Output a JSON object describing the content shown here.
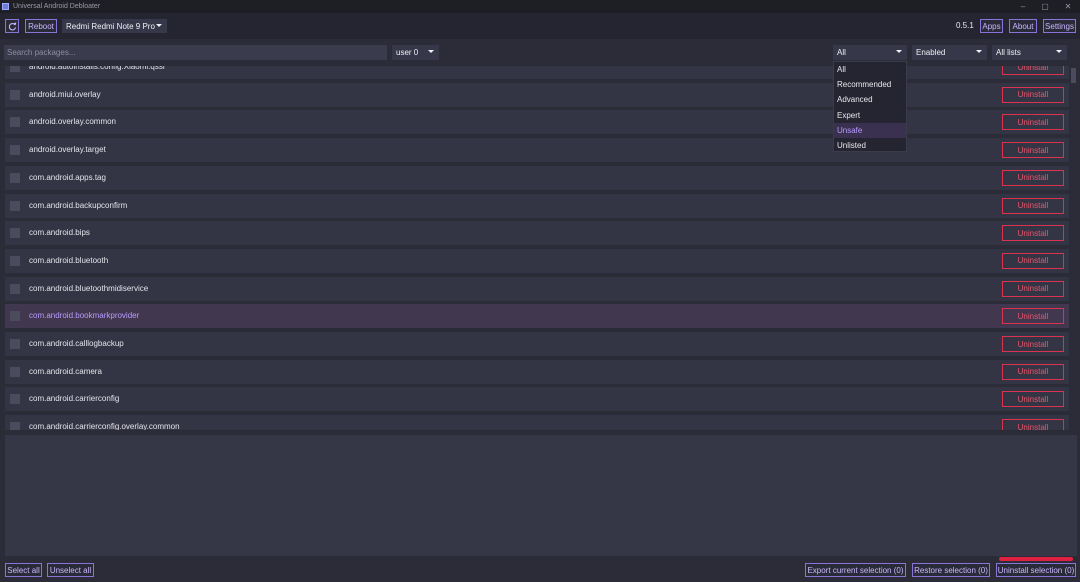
{
  "window": {
    "title": "Universal Android Debloater",
    "controls": [
      "–",
      "▢",
      "✕"
    ]
  },
  "toolbar": {
    "reboot_label": "Reboot",
    "device": "Redmi Redmi Note 9 Pro",
    "version": "0.5.1",
    "apps_label": "Apps",
    "about_label": "About",
    "settings_label": "Settings"
  },
  "filters": {
    "search_placeholder": "Search packages...",
    "user": "user 0",
    "removal": "All",
    "state": "Enabled",
    "list": "All lists",
    "removal_options": [
      "All",
      "Recommended",
      "Advanced",
      "Expert",
      "Unsafe",
      "Unlisted"
    ],
    "hovered_option": "Unsafe"
  },
  "packages": [
    {
      "name": "android.autoinstalls.config.Xiaomi.qssi",
      "action": "Uninstall"
    },
    {
      "name": "android.miui.overlay",
      "action": "Uninstall"
    },
    {
      "name": "android.overlay.common",
      "action": "Uninstall"
    },
    {
      "name": "android.overlay.target",
      "action": "Uninstall"
    },
    {
      "name": "com.android.apps.tag",
      "action": "Uninstall"
    },
    {
      "name": "com.android.backupconfirm",
      "action": "Uninstall"
    },
    {
      "name": "com.android.bips",
      "action": "Uninstall"
    },
    {
      "name": "com.android.bluetooth",
      "action": "Uninstall"
    },
    {
      "name": "com.android.bluetoothmidiservice",
      "action": "Uninstall"
    },
    {
      "name": "com.android.bookmarkprovider",
      "action": "Uninstall"
    },
    {
      "name": "com.android.calllogbackup",
      "action": "Uninstall"
    },
    {
      "name": "com.android.camera",
      "action": "Uninstall"
    },
    {
      "name": "com.android.carrierconfig",
      "action": "Uninstall"
    },
    {
      "name": "com.android.carrierconfig.overlay.common",
      "action": "Uninstall"
    }
  ],
  "selected_package": "com.android.bookmarkprovider",
  "bottom": {
    "select_all": "Select all",
    "unselect_all": "Unselect all",
    "export": "Export current selection (0)",
    "restore": "Restore selection (0)",
    "uninstall": "Uninstall selection (0)"
  },
  "colors": {
    "accent": "#8b74d8",
    "danger": "#d9334f",
    "selected_row": "#41374f"
  }
}
